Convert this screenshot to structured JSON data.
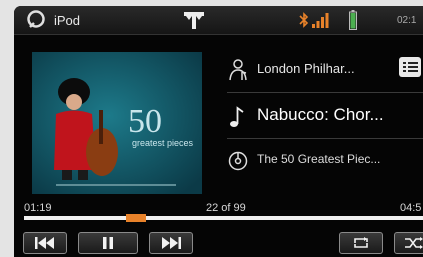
{
  "statusbar": {
    "app_title": "iPod",
    "time": "02:1",
    "icons": [
      "ipod-app-icon",
      "signal-antenna-icon",
      "bluetooth-icon",
      "signal-bars-icon",
      "battery-icon"
    ]
  },
  "now_playing": {
    "artist": "London Philhar...",
    "title": "Nabucco: Chor...",
    "album": "The 50 Greatest Piec..."
  },
  "album_art": {
    "number": "50",
    "subtitle": "greatest pieces"
  },
  "progress": {
    "elapsed": "01:19",
    "track_position": "22 of 99",
    "remaining": "04:5",
    "fraction": 0.28
  },
  "controls": [
    "previous-track",
    "pause",
    "next-track",
    "repeat",
    "shuffle"
  ],
  "colors": {
    "accent": "#e8822a",
    "background": "#050505",
    "battery": "#4caf50"
  }
}
